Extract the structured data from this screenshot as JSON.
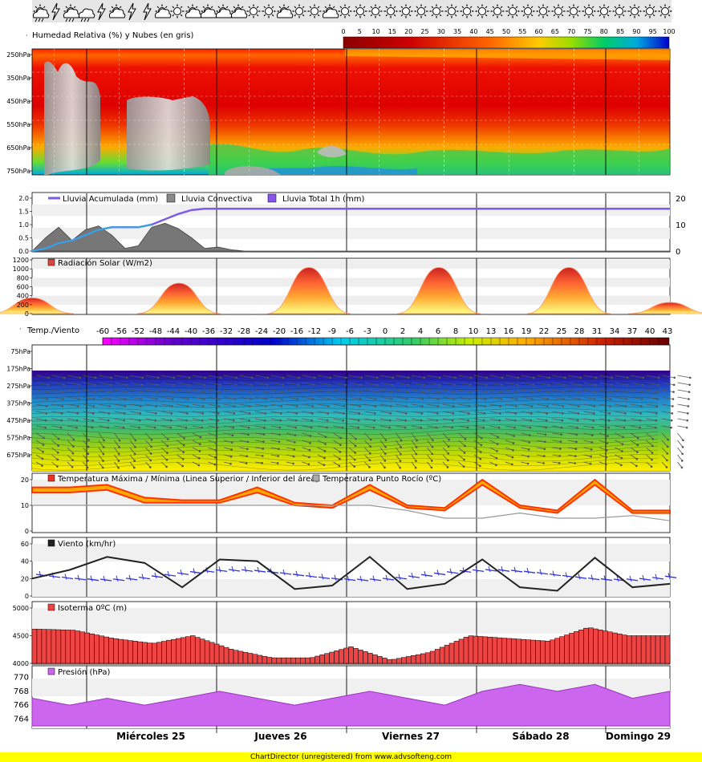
{
  "weather_icons": [
    "sun-cloud-rain",
    "storm",
    "sun-cloud-rain",
    "rain-cloud",
    "storm",
    "sun-cloud",
    "storm",
    "storm",
    "sun-cloud",
    "sun",
    "sun-cloud",
    "sun-cloud",
    "sun-cloud",
    "sun-cloud",
    "sun",
    "sun",
    "sun-cloud",
    "sun",
    "sun",
    "sun-cloud",
    "sun",
    "sun",
    "sun",
    "sun",
    "sun",
    "sun",
    "sun",
    "sun",
    "sun",
    "sun",
    "sun",
    "sun",
    "sun",
    "sun",
    "sun",
    "sun",
    "sun",
    "sun",
    "sun",
    "sun",
    "sun",
    "sun"
  ],
  "day_labels": [
    "Miércoles 25",
    "Jueves 26",
    "Viernes 27",
    "Sábado 28",
    "Domingo 29"
  ],
  "footer_text": "ChartDirector (unregistered) from www.advsofteng.com",
  "colors": {
    "rain_cum": "#7b5ce6",
    "convective": "#808080",
    "rain_total": "#8855ee",
    "tmax": "#ff3300",
    "dew": "#999999",
    "wind": "#000000",
    "wind_barbs": "#3333dd",
    "iso": "#ee4444",
    "pres": "#cc66ee"
  },
  "chart_data": [
    {
      "type": "heatmap",
      "title": "Humedad Relativa (%) y Nubes (en gris)",
      "y_ticks": [
        "250hPa",
        "350hPa",
        "450hPa",
        "550hPa",
        "650hPa",
        "750hPa"
      ],
      "scale_ticks": [
        0,
        5,
        10,
        15,
        20,
        25,
        30,
        35,
        40,
        45,
        50,
        55,
        60,
        65,
        70,
        75,
        80,
        85,
        90,
        95,
        100
      ],
      "grid": true
    },
    {
      "type": "area",
      "legend": [
        "Lluvia Acumulada (mm)",
        "Lluvia Convectiva",
        "Lluvia Total 1h (mm)"
      ],
      "y_left_ticks": [
        "2.0",
        "1.5",
        "1.0",
        "0.5",
        "0.0"
      ],
      "y_right_ticks": [
        "20",
        "10",
        "0"
      ],
      "ylim_left": [
        0,
        2.0
      ],
      "ylim_right": [
        0,
        20
      ],
      "x_hours": [
        0,
        3,
        6,
        9,
        12,
        15,
        18,
        21,
        24,
        27,
        30,
        33,
        36,
        39,
        42,
        45,
        48,
        54,
        60,
        72,
        96,
        120,
        144
      ],
      "convective": [
        0.0,
        0.5,
        0.9,
        0.4,
        0.8,
        0.95,
        0.6,
        0.1,
        0.2,
        0.9,
        1.05,
        0.85,
        0.5,
        0.1,
        0.15,
        0.05,
        0.0,
        0.0,
        0.0,
        0.0,
        0.0,
        0.0,
        0.0
      ],
      "accumulated": [
        0,
        1,
        3,
        4,
        6,
        8,
        9,
        9,
        9,
        10,
        12,
        14,
        15.5,
        16,
        16,
        16,
        16,
        16,
        16,
        16,
        16,
        16,
        16
      ]
    },
    {
      "type": "area",
      "legend": [
        "Radiación Solar (W/m2)"
      ],
      "y_ticks": [
        "1200",
        "1000",
        "800",
        "600",
        "400",
        "200",
        "0"
      ],
      "ylim": [
        0,
        1200
      ],
      "daily_peaks": [
        350,
        680,
        1030,
        1030,
        1030,
        250
      ]
    },
    {
      "type": "heatmap",
      "title": "Temp./Viento",
      "scale_ticks": [
        "-60",
        "-56",
        "-52",
        "-48",
        "-44",
        "-40",
        "-36",
        "-32",
        "-28",
        "-24",
        "-20",
        "-16",
        "-12",
        "-9",
        "-6",
        "-3",
        "0",
        "2",
        "4",
        "6",
        "8",
        "10",
        "13",
        "16",
        "19",
        "22",
        "25",
        "28",
        "31",
        "34",
        "37",
        "40",
        "43"
      ],
      "y_ticks": [
        "75hPa",
        "175hPa",
        "275hPa",
        "375hPa",
        "475hPa",
        "575hPa",
        "675hPa"
      ]
    },
    {
      "type": "line",
      "legend": [
        "Temperatura Máxima / Mínima (Linea Superior / Inferior del área)",
        "Temperatura Punto Rocío (ºC)"
      ],
      "y_ticks": [
        "20",
        "10",
        "0"
      ],
      "ylim": [
        0,
        20
      ],
      "tmax": [
        17,
        17,
        18,
        13,
        12,
        12,
        17,
        11,
        10,
        18,
        10,
        9,
        20,
        10,
        8,
        20,
        8,
        8
      ],
      "tmin": [
        15,
        15,
        16,
        11,
        11,
        11,
        15,
        10,
        9,
        16,
        9,
        8,
        18,
        9,
        7,
        18,
        7,
        7
      ],
      "dew": [
        10,
        10,
        10,
        10,
        10,
        10,
        10,
        10,
        10,
        10,
        8,
        5,
        5,
        7,
        5,
        5,
        6,
        4
      ]
    },
    {
      "type": "line",
      "legend": [
        "Viento (km/hr)"
      ],
      "y_ticks": [
        "60",
        "40",
        "20",
        "0"
      ],
      "ylim": [
        0,
        60
      ],
      "wind": [
        20,
        30,
        45,
        38,
        10,
        42,
        40,
        8,
        12,
        45,
        8,
        14,
        42,
        10,
        6,
        44,
        10,
        14
      ]
    },
    {
      "type": "bar",
      "legend": [
        "Isoterma 0ºC (m)"
      ],
      "y_ticks": [
        "5000",
        "4500",
        "4000"
      ],
      "ylim": [
        4000,
        5000
      ],
      "values": [
        4620,
        4600,
        4450,
        4360,
        4500,
        4250,
        4100,
        4100,
        4300,
        4060,
        4200,
        4500,
        4450,
        4400,
        4650,
        4500,
        4500
      ]
    },
    {
      "type": "area",
      "legend": [
        "Presión (hPa)"
      ],
      "y_ticks": [
        "770",
        "768",
        "766",
        "764"
      ],
      "ylim": [
        763,
        771
      ],
      "values": [
        767,
        766,
        767,
        766,
        767,
        768,
        767,
        766,
        767,
        768,
        767,
        766,
        768,
        769,
        768,
        769,
        767,
        768
      ]
    }
  ]
}
